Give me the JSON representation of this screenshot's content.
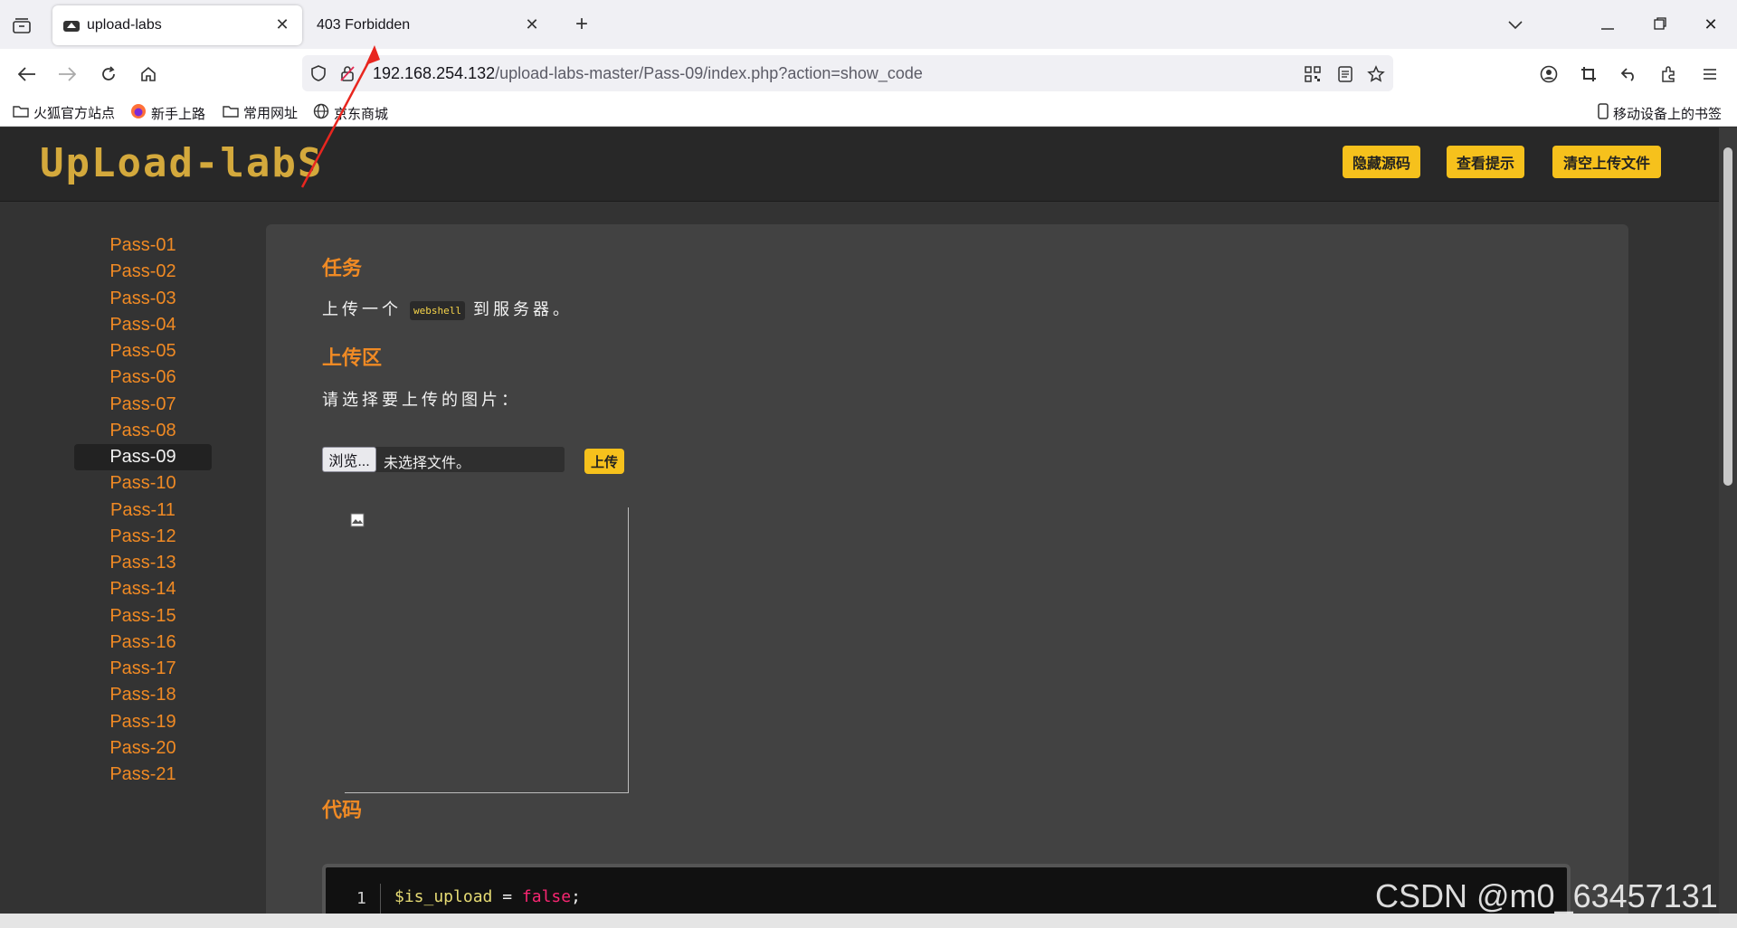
{
  "browser": {
    "tabs": [
      {
        "title": "upload-labs",
        "active": true
      },
      {
        "title": "403 Forbidden",
        "active": false
      }
    ],
    "url_host": "192.168.254.132",
    "url_path": "/upload-labs-master/Pass-09/index.php?action=show_code",
    "bookmarks": [
      "火狐官方站点",
      "新手上路",
      "常用网址",
      "京东商城"
    ],
    "mobile_bookmarks": "移动设备上的书签"
  },
  "site": {
    "logo": "UpLoad-labS",
    "header_buttons": [
      "隐藏源码",
      "查看提示",
      "清空上传文件"
    ]
  },
  "sidebar": {
    "items": [
      "Pass-01",
      "Pass-02",
      "Pass-03",
      "Pass-04",
      "Pass-05",
      "Pass-06",
      "Pass-07",
      "Pass-08",
      "Pass-09",
      "Pass-10",
      "Pass-11",
      "Pass-12",
      "Pass-13",
      "Pass-14",
      "Pass-15",
      "Pass-16",
      "Pass-17",
      "Pass-18",
      "Pass-19",
      "Pass-20",
      "Pass-21"
    ],
    "active": "Pass-09"
  },
  "main": {
    "task_title": "任务",
    "task_prefix": "上传一个",
    "task_code": "webshell",
    "task_suffix": "到服务器。",
    "upload_title": "上传区",
    "upload_prompt": "请选择要上传的图片：",
    "browse_label": "浏览...",
    "file_status": "未选择文件。",
    "upload_label": "上传",
    "code_title": "代码",
    "code_line_no": "1",
    "code_var": "$is_upload",
    "code_op": " = ",
    "code_val": "false",
    "code_end": ";"
  },
  "watermark": "CSDN @m0_63457131",
  "colors": {
    "accent": "#f08a24",
    "button": "#f6c11c",
    "arrow": "#e8261f"
  }
}
